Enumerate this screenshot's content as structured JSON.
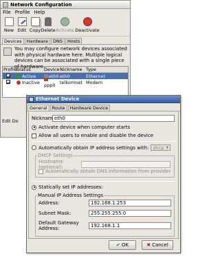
{
  "netconfig": {
    "title": "Network Configuration",
    "menus": [
      "File",
      "Profile",
      "Help"
    ],
    "toolbar": [
      {
        "label": "New",
        "icon": "new-icon",
        "enabled": true
      },
      {
        "label": "Edit",
        "icon": "edit-icon",
        "enabled": true
      },
      {
        "label": "Copy",
        "icon": "copy-icon",
        "enabled": true
      },
      {
        "label": "Delete",
        "icon": "delete-icon",
        "enabled": true
      },
      {
        "label": "Activate",
        "icon": "activate-icon",
        "enabled": false
      },
      {
        "label": "Deactivate",
        "icon": "deactivate-icon",
        "enabled": true
      }
    ],
    "tabs": [
      "Devices",
      "Hardware",
      "DNS",
      "Hosts"
    ],
    "info_text": "You may configure network devices associated with physical hardware here. Multiple logical devices can be associated with a single piece of hardware.",
    "columns": [
      "Profile",
      "Status",
      "Device",
      "Nickname",
      "Type"
    ],
    "rows": [
      {
        "status": "Active",
        "device": "eth0",
        "nickname": "eth0",
        "type": "Ethernet",
        "status_color": "#2e9a2e"
      },
      {
        "status": "Inactive",
        "device": "ppp0",
        "nickname": "telkomnet",
        "type": "Modem",
        "status_color": "#c0392b"
      }
    ],
    "edit_label": "Edit Do"
  },
  "ethernet": {
    "title": "Ethernet Device",
    "tabs": [
      "General",
      "Route",
      "Hardware Device"
    ],
    "nickname_label": "Nickname:",
    "nickname_value": "eth0",
    "activate_on_start": "Activate device when computer starts",
    "allow_users": "Allow all users to enable and disable the device",
    "auto_ip_label": "Automatically obtain IP address settings with:",
    "auto_ip_method": "dhcp",
    "dhcp_settings": "DHCP Settings",
    "hostname_label": "Hostname (optional):",
    "auto_dns": "Automatically obtain DNS information from provider",
    "static_label": "Statically set IP addresses:",
    "manual_group": "Manual IP Address Settings",
    "address_label": "Address:",
    "address_value": "192.168.1.253",
    "subnet_label": "Subnet Mask:",
    "subnet_value": "255.255.255.0",
    "gateway_label": "Default Gateway Address:",
    "gateway_value": "192.168.1.1",
    "ok_label": "OK",
    "cancel_label": "Cancel"
  }
}
